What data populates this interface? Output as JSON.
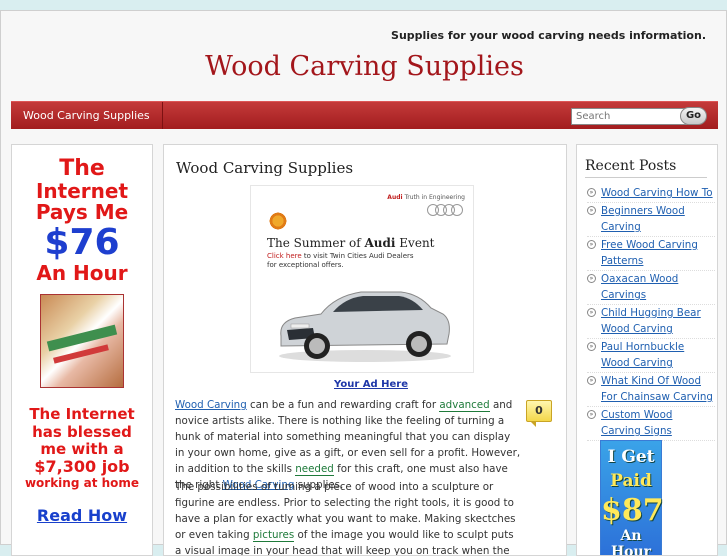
{
  "header": {
    "tagline": "Supplies for your wood carving needs information.",
    "site_title": "Wood Carving Supplies"
  },
  "nav": {
    "home_label": "Wood Carving Supplies",
    "search_placeholder": "Search",
    "go_label": "Go"
  },
  "left_ad": {
    "line1": "The",
    "line2": "Internet",
    "line3": "Pays Me",
    "line4": "$76",
    "line5": "An Hour",
    "block2_line1": "The Internet",
    "block2_line2": "has blessed",
    "block2_line3": "me with a",
    "block2_line4": "$7,300 job",
    "block2_line5": "working at home",
    "read_how": "Read How"
  },
  "main": {
    "title": "Wood Carving Supplies",
    "banner": {
      "brand_small": "Audi",
      "brand_tag": "Truth in Engineering",
      "headline_pre": "The Summer of ",
      "headline_bold": "Audi",
      "headline_post": " Event",
      "click_here": "Click here",
      "sub_text": " to visit Twin Cities Audi Dealers",
      "sub_text2": "for exceptional offers."
    },
    "ad_link": "Your Ad Here",
    "comment_count": "0",
    "p1": {
      "link1": "Wood Carving",
      "t1": " can be a fun and rewarding craft for ",
      "hl1": "advanced",
      "t2": " and novice artists alike. There is nothing like the feeling of turning a hunk of material into something meaningful that you can display in your own home, give as a gift, or even sell for a profit. However, in addition to the skills ",
      "hl2": "needed",
      "t3": " for this craft, one must also have the right ",
      "link2": "Wood Carving",
      "t4": " supplies."
    },
    "p2": {
      "t1": "The possibilities of turning a piece of wood into a sculpture or figurine are endless. Prior to selecting the right tools, it is good to have a plan for exactly what you want to make. Making skectches or even taking ",
      "hl1": "pictures",
      "t2": " of the image you would like to sculpt puts a visual image in your head that will keep you on track when the carving begins. Also, before selecting supplies, you should take"
    }
  },
  "sidebar": {
    "recent_title": "Recent Posts",
    "posts": [
      "Wood Carving How To",
      "Beginners Wood Carving",
      "Free Wood Carving Patterns",
      "Oaxacan Wood Carvings",
      "Child Hugging Bear Wood Carving",
      "Paul Hornbuckle Wood Carving",
      "What Kind Of Wood For Chainsaw Carving",
      "Custom Wood Carving Signs"
    ],
    "ad": {
      "line1": "I Get",
      "line2": "Paid",
      "line3": "$87",
      "line4": "An Hour"
    }
  }
}
